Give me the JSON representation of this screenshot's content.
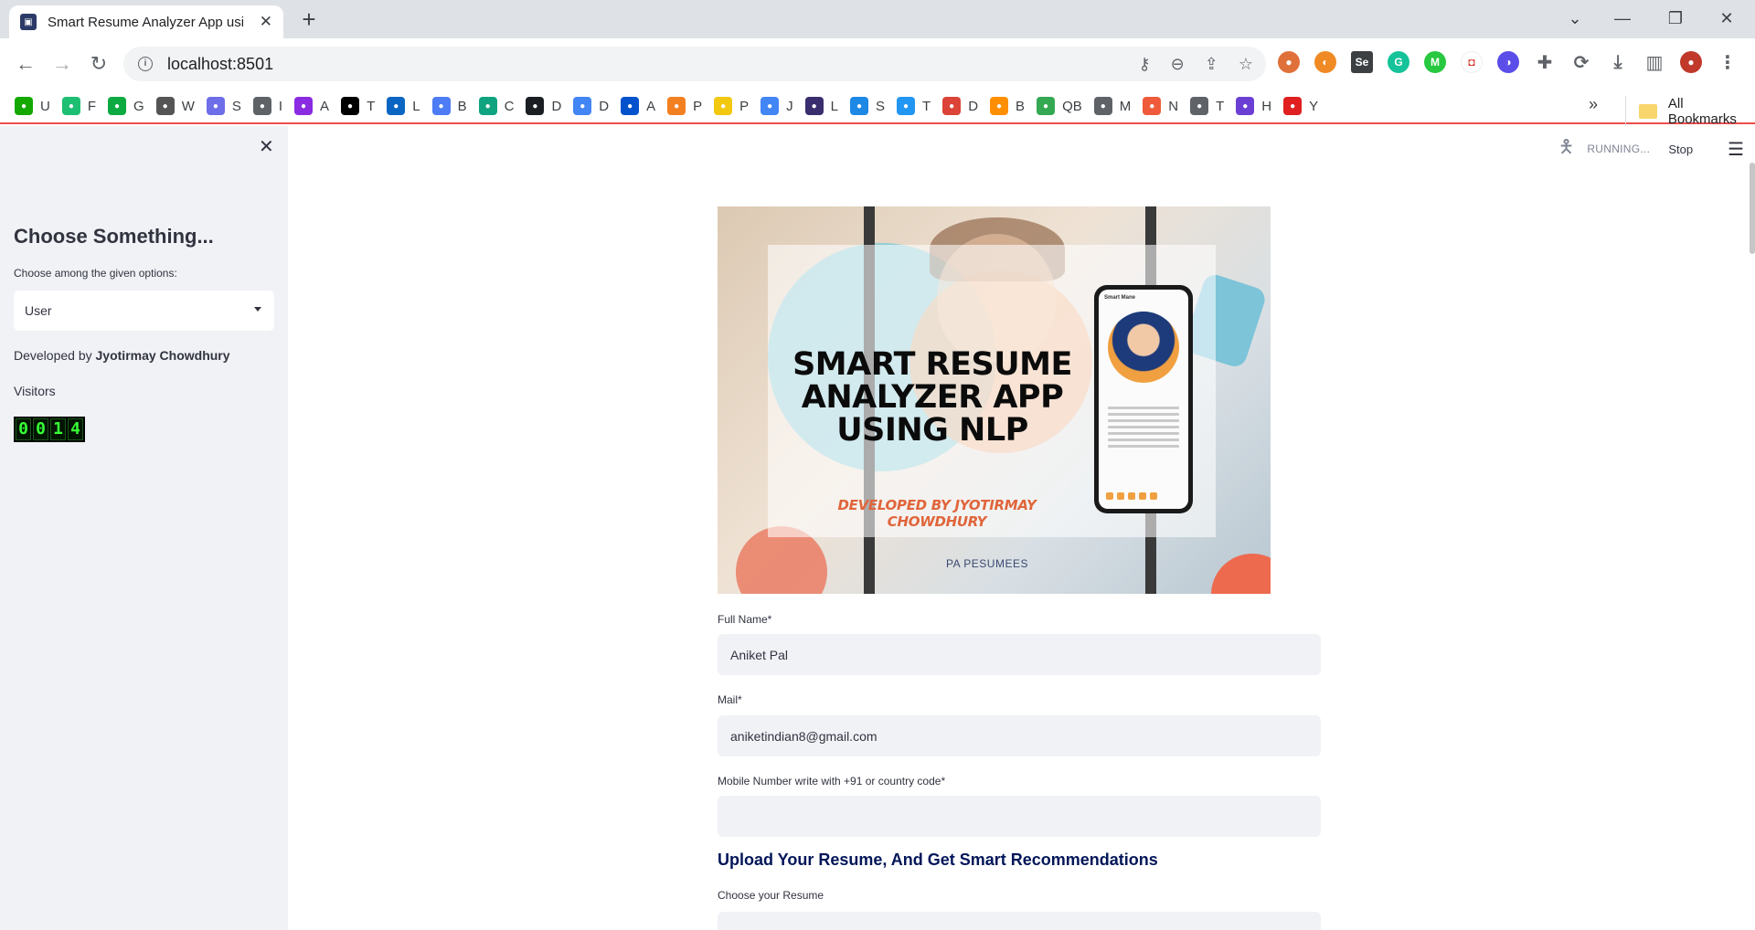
{
  "browser": {
    "tab_title": "Smart Resume Analyzer App usi",
    "url": "localhost:8501",
    "bookmarks": [
      {
        "label": "U",
        "icon": "upwork-icon",
        "color": "#14a800"
      },
      {
        "label": "F",
        "icon": "fiverr-icon",
        "color": "#1dbf73"
      },
      {
        "label": "G",
        "icon": "glassdoor-icon",
        "color": "#0caa41"
      },
      {
        "label": "W",
        "icon": "w-icon",
        "color": "#555555"
      },
      {
        "label": "S",
        "icon": "s-wave-icon",
        "color": "#6e6ee8"
      },
      {
        "label": "I",
        "icon": "globe-icon",
        "color": "#5f6368"
      },
      {
        "label": "A",
        "icon": "arrow-purple-icon",
        "color": "#8a2be2"
      },
      {
        "label": "T",
        "icon": "x-twitter-icon",
        "color": "#000000"
      },
      {
        "label": "L",
        "icon": "linkedin-icon",
        "color": "#0a66c2"
      },
      {
        "label": "B",
        "icon": "gemini-icon",
        "color": "#4e7cf5"
      },
      {
        "label": "C",
        "icon": "chatgpt-icon",
        "color": "#10a37f"
      },
      {
        "label": "D",
        "icon": "github-icon",
        "color": "#1b1f23"
      },
      {
        "label": "D",
        "icon": "docs-icon",
        "color": "#4285f4"
      },
      {
        "label": "A",
        "icon": "atlassian-icon",
        "color": "#0052cc"
      },
      {
        "label": "P",
        "icon": "cloudflare-icon",
        "color": "#f38020"
      },
      {
        "label": "P",
        "icon": "powerbi-icon",
        "color": "#f2c811"
      },
      {
        "label": "J",
        "icon": "docs-icon",
        "color": "#4285f4"
      },
      {
        "label": "L",
        "icon": "logo-icon",
        "color": "#3b2e6e"
      },
      {
        "label": "S",
        "icon": "s-circle-icon",
        "color": "#1e88e5"
      },
      {
        "label": "T",
        "icon": "upload-icon",
        "color": "#2196f3"
      },
      {
        "label": "D",
        "icon": "chrome-icon",
        "color": "#db4437"
      },
      {
        "label": "B",
        "icon": "blogger-icon",
        "color": "#ff8f00"
      },
      {
        "label": "QB",
        "icon": "bot-icon",
        "color": "#34a853"
      },
      {
        "label": "M",
        "icon": "mail-icon",
        "color": "#5f6368"
      },
      {
        "label": "N",
        "icon": "n-icon",
        "color": "#ef5b3a"
      },
      {
        "label": "T",
        "icon": "globe-icon",
        "color": "#5f6368"
      },
      {
        "label": "H",
        "icon": "h-icon",
        "color": "#6c3fd4"
      },
      {
        "label": "Y",
        "icon": "y-icon",
        "color": "#e02020"
      }
    ],
    "all_bookmarks": "All Bookmarks"
  },
  "sidebar": {
    "title": "Choose Something...",
    "select_label": "Choose among the given options:",
    "select_value": "User",
    "developed_prefix": "Developed by",
    "developer": "Jyotirmay Chowdhury",
    "visitors_label": "Visitors",
    "visitor_digits": [
      "0",
      "0",
      "1",
      "4"
    ]
  },
  "header": {
    "status": "RUNNING...",
    "stop": "Stop"
  },
  "hero": {
    "title_line1": "SMART RESUME",
    "title_line2": "ANALYZER APP",
    "title_line3": "USING NLP",
    "subtitle": "DEVELOPED BY JYOTIRMAY CHOWDHURY",
    "phone_heading": "Smart Mane",
    "bottom_text": "PA PESUMEES"
  },
  "form": {
    "name_label": "Full Name*",
    "name_value": "Aniket Pal",
    "mail_label": "Mail*",
    "mail_value": "aniketindian8@gmail.com",
    "mobile_label": "Mobile Number write with +91 or country code*",
    "mobile_value": "",
    "section_title": "Upload Your Resume, And Get Smart Recommendations",
    "resume_label": "Choose your Resume"
  }
}
